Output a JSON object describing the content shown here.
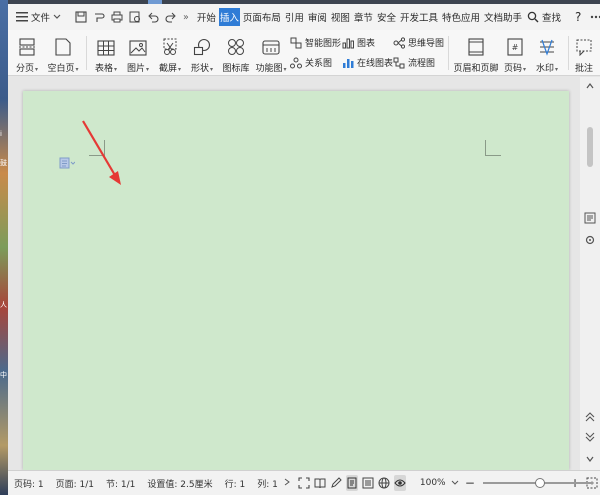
{
  "menubar": {
    "file_label": "文件",
    "tabs": [
      {
        "label": "开始",
        "active": false
      },
      {
        "label": "插入",
        "active": true
      },
      {
        "label": "页面布局",
        "active": false
      },
      {
        "label": "引用",
        "active": false
      },
      {
        "label": "审阅",
        "active": false
      },
      {
        "label": "视图",
        "active": false
      },
      {
        "label": "章节",
        "active": false
      },
      {
        "label": "安全",
        "active": false
      },
      {
        "label": "开发工具",
        "active": false
      },
      {
        "label": "特色应用",
        "active": false
      },
      {
        "label": "文档助手",
        "active": false
      }
    ],
    "search_label": "查找",
    "help_label": "?",
    "more_label": "»",
    "accent_color": "#2f7cd6"
  },
  "ribbon": {
    "page_break": "分页",
    "blank_page": "空白页",
    "table": "表格",
    "picture": "图片",
    "screenshot": "截屏",
    "shapes": "形状",
    "icon_library": "图标库",
    "function_chart": "功能图",
    "smart_shape": "智能图形",
    "chart": "图表",
    "mind_map": "思维导图",
    "relation_chart": "关系图",
    "online_chart": "在线图表",
    "flowchart": "流程图",
    "header_footer": "页眉和页脚",
    "page_number": "页码",
    "watermark": "水印",
    "annotation": "批注"
  },
  "desktop_strip": [
    "人",
    "中",
    "i",
    "鼓"
  ],
  "document": {
    "page_color": "#cfe8cc",
    "annotation_arrow_color": "#e53935"
  },
  "statusbar": {
    "page": "页码: 1",
    "pages": "页面: 1/1",
    "section": "节: 1/1",
    "setting": "设置值: 2.5厘米",
    "row": "行: 1",
    "col": "列: 1",
    "zoom": "100%",
    "zoom_fraction": 0.52,
    "minus": "−",
    "plus": "+"
  }
}
